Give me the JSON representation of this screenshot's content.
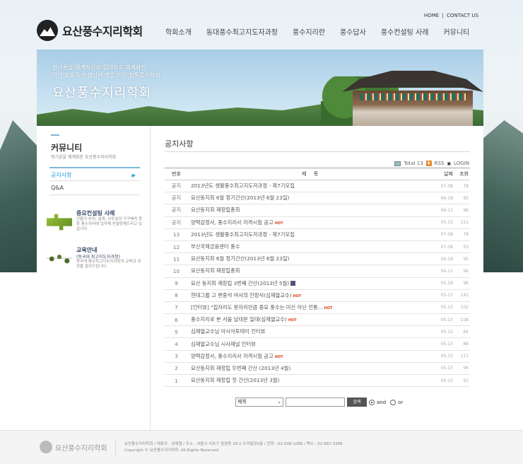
{
  "header": {
    "logo_text": "요산풍수지리학회",
    "util": {
      "home": "HOME",
      "sep": "|",
      "contact": "CONTACT US"
    },
    "gnb": [
      "학회소개",
      "동대풍수최고지도자과정",
      "풍수지리란",
      "풍수답사",
      "풍수컨설팅 사례",
      "커뮤니티"
    ]
  },
  "visual": {
    "copy_line1": "형기론을 체계적으로 집약하고 체계화한",
    "copy_line2": "하남 장용득 선생님의 맥을 이은 정통풍수학회",
    "copy_title": "요산풍수지리학회"
  },
  "lnb": {
    "title": "커뮤니티",
    "subtitle": "형기론을 체계화한 요산풍수지리학회",
    "menu": [
      {
        "label": "공지사항",
        "arrow": "▶"
      },
      {
        "label": "Q&A"
      }
    ],
    "promo1": {
      "title": "중요컨설팅 사례",
      "desc": "건물의 위치, 설계, 사무실의 가구배치 등등 풍수지리에 입각해 컨설팅해드리고 있습니다."
    },
    "promo2": {
      "title": "교육안내",
      "subtitle": "(동국대 최고지도자과정)",
      "desc": "동국대 풍수최고지도자과정의 교육과 과정을 알려드립니다."
    }
  },
  "board": {
    "title": "공지사항",
    "total_label": "Total 13",
    "rss": "RSS",
    "login": "LOGIN",
    "headers": {
      "num": "번호",
      "subject": "제 목",
      "date": "날짜",
      "views": "조회"
    },
    "hot_label": "HOT",
    "rows": [
      {
        "num": "공지",
        "subject": "2013년도 생활풍수최고지도자과정 - 제7기모집",
        "date": "07-08",
        "views": "78"
      },
      {
        "num": "공지",
        "subject": "요산동지회 6월 정기간산(2013년 6월 23일)",
        "date": "06-18",
        "views": "95"
      },
      {
        "num": "공지",
        "subject": "요산동지회 재창립총회",
        "date": "06-11",
        "views": "96"
      },
      {
        "num": "공지",
        "subject": "양택감정사, 풍수지리사 자격시험 공고",
        "date": "05-15",
        "views": "121",
        "hot": true
      },
      {
        "num": "13",
        "subject": "2013년도 생활풍수최고지도자과정 - 제7기모집",
        "date": "07-08",
        "views": "78"
      },
      {
        "num": "12",
        "subject": "부산국제금융센터 풍수",
        "date": "07-08",
        "views": "53"
      },
      {
        "num": "11",
        "subject": "요산동지회 6월 정기간산(2013년 6월 23일)",
        "date": "06-18",
        "views": "95"
      },
      {
        "num": "10",
        "subject": "요산동지회 재창립총회",
        "date": "06-11",
        "views": "96"
      },
      {
        "num": "9",
        "subject": "요산 동지회 재창립 3번째 간산(2013년 5월)",
        "date": "05-28",
        "views": "96",
        "file": true
      },
      {
        "num": "8",
        "subject": "현대그룹 고 변중석 여사의 안장식(심재열교수)",
        "date": "05-15",
        "views": "142",
        "hot": true
      },
      {
        "num": "7",
        "subject": "[인터뷰] \"집자리도 못자리만큼 중요 풍수는 미신 아닌 전통...",
        "date": "05-15",
        "views": "102",
        "hot": true
      },
      {
        "num": "6",
        "subject": "풍수지리로 본 서울 남대문 일대(심재열교수)",
        "date": "05-15",
        "views": "108",
        "hot": true
      },
      {
        "num": "5",
        "subject": "심재열교수님 아시아투데이 인터뷰",
        "date": "05-15",
        "views": "84"
      },
      {
        "num": "4",
        "subject": "심재열교수님 시사재널 인터뷰",
        "date": "05-15",
        "views": "88"
      },
      {
        "num": "3",
        "subject": "양택감정사, 풍수지리사 자격시험 공고",
        "date": "05-15",
        "views": "121",
        "hot": true
      },
      {
        "num": "2",
        "subject": "요산동지회 재창립 두번째 간산 (2013년 4월)",
        "date": "05-15",
        "views": "96"
      },
      {
        "num": "1",
        "subject": "요산동지회 재창립 첫 간산(2013년 3월)",
        "date": "05-15",
        "views": "91"
      }
    ]
  },
  "search": {
    "select_value": "제목",
    "input_value": "",
    "button": "검색",
    "radio_and": "and",
    "radio_or": "or"
  },
  "footer": {
    "logo_text": "요산풍수지리학회",
    "line1": "요산풍수지리학회 / 대표자 : 심재열 / 주소 : 서울시 서초구 잠원동 28-1 두꺼빌딩5층 / 전화 : 02-508-1088 / 팩스 : 02-887-3388",
    "line2": "Copyright © 요산풍수지리학회. All Rights Reserved."
  }
}
